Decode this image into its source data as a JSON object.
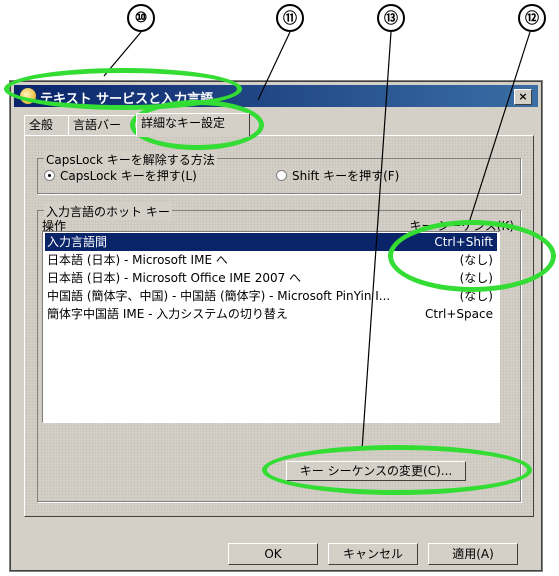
{
  "callouts": [
    "⑩",
    "⑪",
    "⑬",
    "⑫"
  ],
  "window": {
    "title": "テキスト サービスと入力言語",
    "close_glyph": "×"
  },
  "tabs": [
    "全般",
    "言語バー",
    "詳細なキー設定"
  ],
  "capslock": {
    "group_label": "CapsLock キーを解除する方法",
    "option1": "CapsLock キーを押す(L)",
    "option2": "Shift キーを押す(F)"
  },
  "hotkeys": {
    "group_label": "入力言語のホット キー",
    "col_action": "操作",
    "col_key": "キー シーケンス(K)",
    "rows": [
      {
        "action": "入力言語間",
        "key": "Ctrl+Shift"
      },
      {
        "action": "日本語 (日本) - Microsoft IME へ",
        "key": "(なし)"
      },
      {
        "action": "日本語 (日本) - Microsoft Office IME 2007 へ",
        "key": "(なし)"
      },
      {
        "action": "中国語 (簡体字、中国) - 中国語 (簡体字) - Microsoft PinYin I...",
        "key": "(なし)"
      },
      {
        "action": "簡体字中国語 IME - 入力システムの切り替え",
        "key": "Ctrl+Space"
      }
    ],
    "change_button": "キー シーケンスの変更(C)..."
  },
  "footer": {
    "ok": "OK",
    "cancel": "キャンセル",
    "apply": "適用(A)"
  },
  "colors": {
    "highlight_ellipse": "#33dd33",
    "titlebar": "#0a246a",
    "selection": "#0a246a"
  }
}
